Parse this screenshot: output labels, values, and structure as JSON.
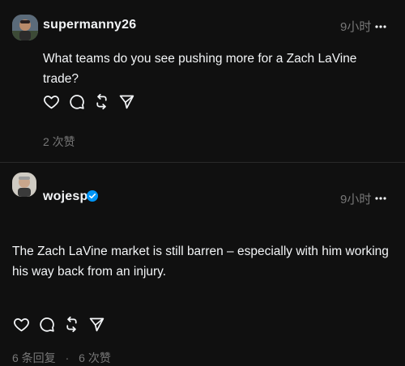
{
  "colors": {
    "background": "#101010",
    "text_primary": "#f3f5f7",
    "text_secondary": "#777777",
    "verified_blue": "#0095f6"
  },
  "posts": [
    {
      "username": "supermanny26",
      "time": "9小时",
      "text": "What teams do you see pushing more for a Zach LaVine trade?",
      "likes": "2 次赞",
      "icons": [
        "heart-icon",
        "comment-icon",
        "repost-icon",
        "share-icon",
        "more-icon"
      ]
    },
    {
      "username": "wojespn",
      "verified": true,
      "time": "9小时",
      "text": "The Zach LaVine market is still barren – especially with him working his way back from an injury.",
      "replies": "6 条回复",
      "likes": "6 次赞",
      "icons": [
        "heart-icon",
        "comment-icon",
        "repost-icon",
        "share-icon",
        "more-icon"
      ]
    }
  ]
}
